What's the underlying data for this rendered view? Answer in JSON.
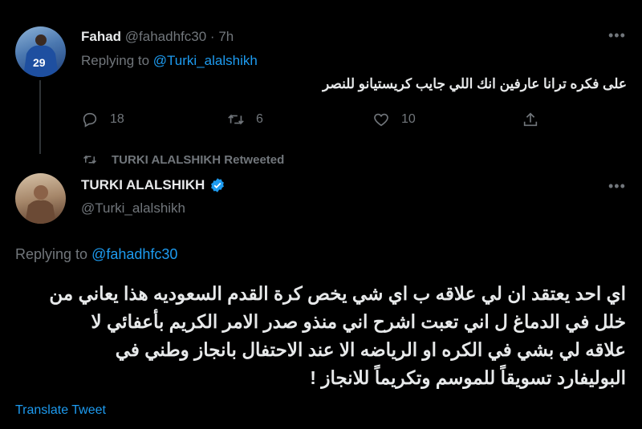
{
  "reply_tweet": {
    "name": "Fahad",
    "handle": "@fahadhfc30",
    "separator": "·",
    "time": "7h",
    "replying_label": "Replying to",
    "replying_to": "@Turki_alalshikh",
    "text": "على فكره ترانا عارفين انك اللي جايب كريستيانو للنصر",
    "reply_count": "18",
    "retweet_count": "6",
    "like_count": "10"
  },
  "main_tweet": {
    "retweeted_by": "TURKI ALALSHIKH Retweeted",
    "name": "TURKI ALALSHIKH",
    "handle": "@Turki_alalshikh",
    "replying_label": "Replying to",
    "replying_to": "@fahadhfc30",
    "text_lines": [
      "اي احد يعتقد ان لي علاقه ب اي شي يخص كرة القدم السعوديه هذا يعاني من",
      "خلل في الدماغ ل اني تعبت اشرح اني منذو صدر الامر الكريم بأعفائي لا",
      "علاقه لي بشي في الكره او الرياضه الا عند الاحتفال بانجاز وطني في",
      "البوليفارد تسويقاً للموسم وتكريماً للانجاز !"
    ],
    "translate_label": "Translate Tweet",
    "verified_color": "#1d9bf0"
  }
}
